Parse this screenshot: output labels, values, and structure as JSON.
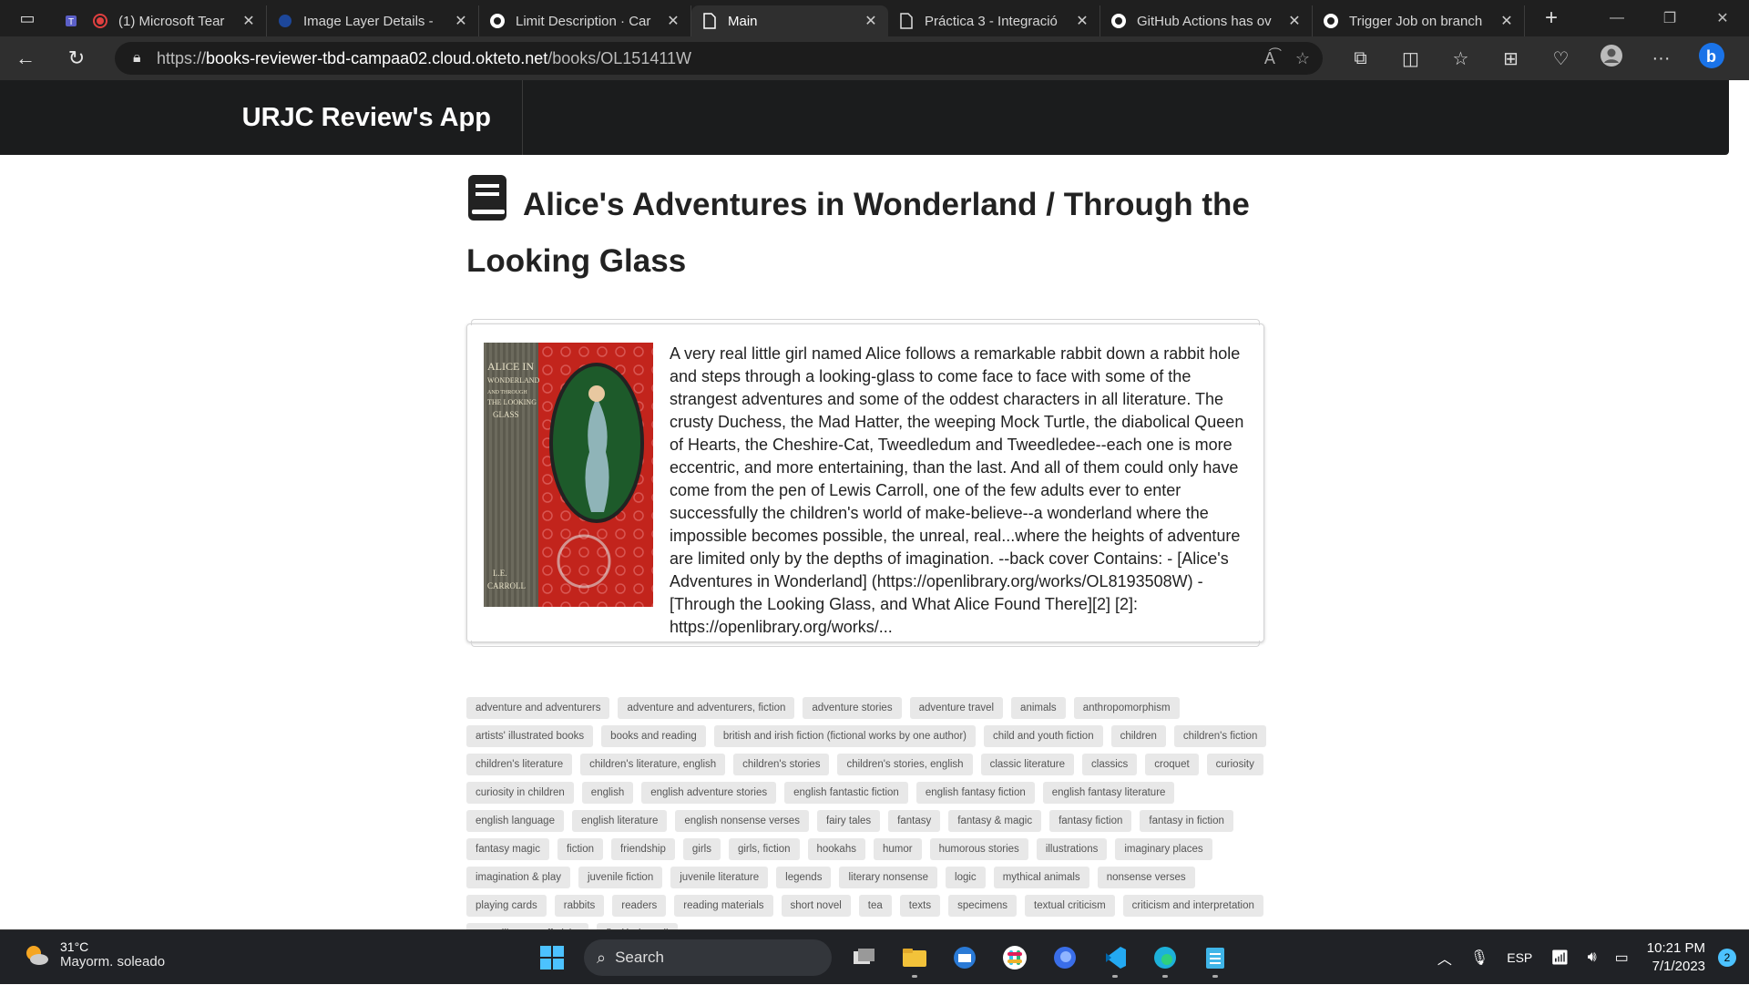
{
  "browser": {
    "tabs": [
      {
        "label": "(1) Microsoft Tear",
        "icon": "teams-icon"
      },
      {
        "label": "Image Layer Details - ",
        "icon": "docker-icon"
      },
      {
        "label": "Limit Description · Car",
        "icon": "github-icon"
      },
      {
        "label": "Main",
        "icon": "document-icon",
        "active": true
      },
      {
        "label": "Práctica 3 - Integració",
        "icon": "document-icon"
      },
      {
        "label": "GitHub Actions has ov",
        "icon": "github-icon"
      },
      {
        "label": "Trigger Job on branch",
        "icon": "github-icon"
      }
    ],
    "url_prefix": "https://",
    "url_host": "books-reviewer-tbd-campaa02.cloud.okteto.net",
    "url_path": "/books/OL151411W"
  },
  "app": {
    "brand": "URJC Review's App"
  },
  "book": {
    "title": "Alice's Adventures in Wonderland / Through the Looking Glass",
    "cover_text_top": "ALICE IN WONDERLAND AND THROUGH THE LOOKING GLASS",
    "cover_text_bottom": "L.E. CARROLL",
    "description": "A very real little girl named Alice follows a remarkable rabbit down a rabbit hole and steps through a looking-glass to come face to face with some of the strangest adventures and some of the oddest characters in all literature. The crusty Duchess, the Mad Hatter, the weeping Mock Turtle, the diabolical Queen of Hearts, the Cheshire-Cat, Tweedledum and Tweedledee--each one is more eccentric, and more entertaining, than the last. And all of them could only have come from the pen of Lewis Carroll, one of the few adults ever to enter successfully the children's world of make-believe--a wonderland where the impossible becomes possible, the unreal, real...where the heights of adventure are limited only by the depths of imagination. --back cover Contains: - [Alice's Adventures in Wonderland] (https://openlibrary.org/works/OL8193508W) - [Through the Looking Glass, and What Alice Found There][2] [2]: https://openlibrary.org/works/..."
  },
  "subjects": [
    "adventure and adventurers",
    "adventure and adventurers, fiction",
    "adventure stories",
    "adventure travel",
    "animals",
    "anthropomorphism",
    "artists' illustrated books",
    "books and reading",
    "british and irish fiction (fictional works by one author)",
    "child and youth fiction",
    "children",
    "children's fiction",
    "children's literature",
    "children's literature, english",
    "children's stories",
    "children's stories, english",
    "classic literature",
    "classics",
    "croquet",
    "curiosity",
    "curiosity in children",
    "english",
    "english adventure stories",
    "english fantastic fiction",
    "english fantasy fiction",
    "english fantasy literature",
    "english language",
    "english literature",
    "english nonsense verses",
    "fairy tales",
    "fantasy",
    "fantasy & magic",
    "fantasy fiction",
    "fantasy in fiction",
    "fantasy magic",
    "fiction",
    "friendship",
    "girls",
    "girls, fiction",
    "hookahs",
    "humor",
    "humorous stories",
    "illustrations",
    "imaginary places",
    "imagination & play",
    "juvenile fiction",
    "juvenile literature",
    "legends",
    "literary nonsense",
    "logic",
    "mythical animals",
    "nonsense verses",
    "playing cards",
    "rabbits",
    "readers",
    "reading materials",
    "short novel",
    "tea",
    "texts",
    "specimens",
    "textual criticism",
    "criticism and interpretation",
    "open library staff picks",
    "ficción juvenil"
  ],
  "taskbar": {
    "temperature": "31°C",
    "weather_desc": "Mayorm. soleado",
    "search_label": "Search",
    "language": "ESP",
    "time": "10:21 PM",
    "date": "7/1/2023",
    "notification_count": "2"
  },
  "colors": {
    "accent": "#4cc2ff",
    "nav_bg": "#1b1c1d",
    "tag_bg": "#e8e8e8"
  }
}
